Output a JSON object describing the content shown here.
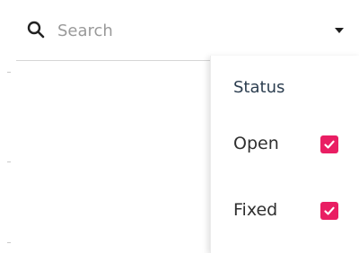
{
  "search": {
    "placeholder": "Search",
    "value": ""
  },
  "filter_menu": {
    "title": "Status",
    "options": [
      {
        "label": "Open",
        "checked": true
      },
      {
        "label": "Fixed",
        "checked": true
      }
    ]
  },
  "colors": {
    "checkbox_accent": "#e91e63",
    "title_text": "#2c3e50"
  },
  "icons": {
    "search": "search-icon",
    "dropdown": "caret-down-icon",
    "check": "check-icon"
  }
}
